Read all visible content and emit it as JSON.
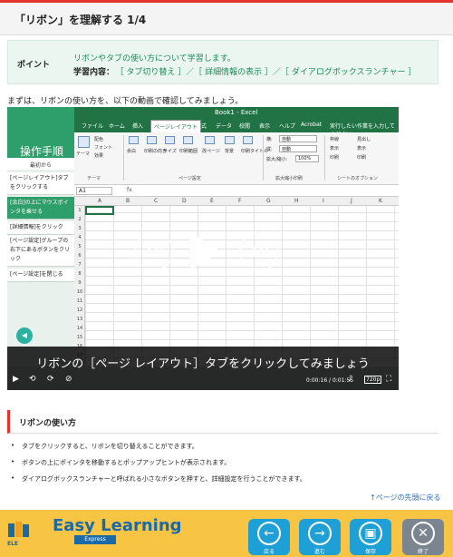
{
  "header": {
    "title": "「リボン」を理解する 1/4"
  },
  "point": {
    "label": "ポイント",
    "line1": "リボンやタブの使い方について学習します。",
    "content_label": "学習内容：",
    "content_value": "［ タブ切り替え ］／［ 詳細情報の表示 ］／［ ダイアログボックスランチャー ］"
  },
  "intro": "まずは、リボンの使い方を、以下の動画で確認してみましょう。",
  "video": {
    "excel_title": "Book1 - Excel",
    "tabs": [
      "ファイル",
      "ホーム",
      "挿入",
      "ページレイアウト",
      "数式",
      "データ",
      "校閲",
      "表示",
      "ヘルプ",
      "Acrobat"
    ],
    "active_tab_index": 3,
    "search_placeholder": "実行したい作業を入力してください",
    "ribbon_groups": {
      "theme": "テーマ",
      "page_setup": "ページ設定",
      "scale": "拡大縮小印刷",
      "sheet": "シートのオプション"
    },
    "ribbon_labels": {
      "colors": "配色",
      "fonts": "フォント",
      "effects": "効果",
      "theme_btn": "テーマ",
      "margins": "余白",
      "orientation": "印刷の向き",
      "size": "サイズ",
      "print_area": "印刷範囲",
      "breaks": "改ページ",
      "background": "背景",
      "print_titles": "印刷タイトル",
      "width": "横:",
      "height": "縦:",
      "auto": "自動",
      "scale_label": "拡大/縮小:",
      "scale_value": "100%",
      "gridlines": "枠線",
      "headings": "見出し",
      "view": "表示",
      "print": "印刷"
    },
    "name_box": "A1",
    "fx": "fx",
    "columns": [
      "A",
      "B",
      "C",
      "D",
      "E",
      "F",
      "G",
      "H",
      "I",
      "J",
      "K"
    ],
    "rows": [
      "1",
      "2",
      "3",
      "4",
      "5",
      "6",
      "7",
      "8",
      "9",
      "10",
      "11",
      "12",
      "13",
      "14",
      "15",
      "16",
      "17"
    ],
    "sidebar_title": "操作手順",
    "sidebar_sub": "最初から",
    "steps": [
      "[ページレイアウト]タブをクリックする",
      "[余白]の上にマウスポインタを乗せる",
      "[詳細情報]をクリック",
      "[ページ設定]グループの右下にあるボタンをクリック",
      "[ページ設定]を閉じる"
    ],
    "active_step": 1,
    "skip_back": "10",
    "skip_forward": "10",
    "caption": "リボンの［ページ レイアウト］タブをクリックしてみましょう",
    "time": "0:00:16 / 0:01:55",
    "quality": "720p"
  },
  "section": {
    "title": "リボンの使い方",
    "bullets": [
      "タブをクリックすると、リボンを切り替えることができます。",
      "ボタンの上にポインタを移動するとポップアップヒントが表示されます。",
      "ダイアログボックスランチャーと呼ばれる小さなボタンを押すと、詳細設定を行うことができます。"
    ]
  },
  "to_top": "↑ページの先頭に戻る",
  "footer": {
    "logo_main": "Easy Learning",
    "logo_sub": "Express",
    "logo_small": "ELE",
    "buttons": [
      {
        "label": "戻る",
        "icon": "←"
      },
      {
        "label": "進む",
        "icon": "→"
      },
      {
        "label": "保存",
        "icon": "▣"
      },
      {
        "label": "終了",
        "icon": "✕"
      }
    ]
  }
}
